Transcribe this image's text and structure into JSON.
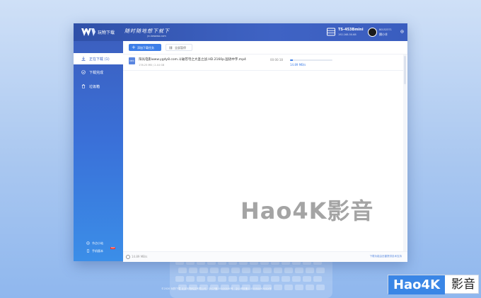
{
  "titlebar": {
    "app_name": "玩物下载",
    "slogan": "随时随地想下就下",
    "slogan_url": "yc.iowowo.com",
    "device_name": "TS-453Bmini",
    "device_ip": "192.168.50.68",
    "user_id": "80152371",
    "user_name": "隔小羊"
  },
  "sidebar": {
    "items": [
      {
        "label": "正在下载 (1)",
        "icon": "download-icon",
        "active": true
      },
      {
        "label": "下载完成",
        "icon": "check-circle-icon",
        "active": false
      },
      {
        "label": "垃圾箱",
        "icon": "trash-icon",
        "active": false
      }
    ],
    "footer": [
      {
        "label": "节点小站",
        "icon": "node-icon"
      },
      {
        "label": "手机版本",
        "icon": "phone-icon",
        "badge": "HOT"
      }
    ]
  },
  "toolbar": {
    "add_label": "添加下载任务",
    "pause_all_label": "全部暂停"
  },
  "downloads": [
    {
      "file_name": "阳光电影www.ygdy8.com.斗破苍穹之大圣之战.HD.2160p.国语中字.mp4",
      "size_text": "178.25 MB / 2.44 GB",
      "time_left": "00:00:18",
      "progress": 0.07,
      "speed": "14.89 MB/s"
    }
  ],
  "statusbar": {
    "speed": "14.89 MB/s",
    "note": "下载功能由迅雷提供技术支持"
  },
  "watermark": {
    "center": "Hao4K影音",
    "badge_part1": "Hao4K",
    "badge_part2": "影音"
  },
  "footer_text": "©2020 玩物下载 北京玩物科技有限公司 · 京ICP备2014XXXX号 · 京公网安备110108XXXXXXX号"
}
